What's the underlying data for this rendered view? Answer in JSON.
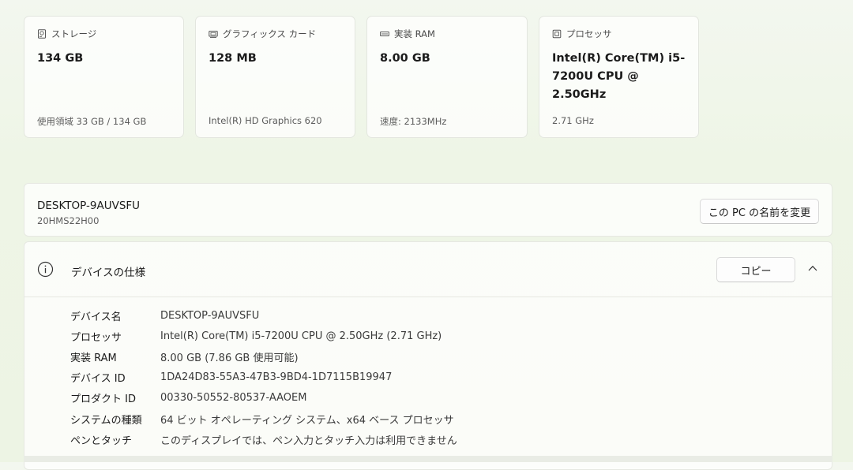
{
  "cards": [
    {
      "label": "ストレージ",
      "value": "134 GB",
      "sub": "使用領域 33 GB / 134 GB",
      "icon": "storage-icon"
    },
    {
      "label": "グラフィックス カード",
      "value": "128 MB",
      "sub": "Intel(R) HD Graphics 620",
      "icon": "graphics-card-icon"
    },
    {
      "label": "実装 RAM",
      "value": "8.00 GB",
      "sub": "速度: 2133MHz",
      "icon": "ram-icon"
    },
    {
      "label": "プロセッサ",
      "value": "Intel(R) Core(TM) i5-7200U CPU @ 2.50GHz",
      "sub": "2.71 GHz",
      "icon": "processor-icon"
    }
  ],
  "device": {
    "name": "DESKTOP-9AUVSFU",
    "model": "20HMS22H00",
    "rename_label": "この PC の名前を変更"
  },
  "specs": {
    "title": "デバイスの仕様",
    "copy_label": "コピー",
    "rows": [
      {
        "k": "デバイス名",
        "v": "DESKTOP-9AUVSFU"
      },
      {
        "k": "プロセッサ",
        "v": "Intel(R) Core(TM) i5-7200U CPU @ 2.50GHz (2.71 GHz)"
      },
      {
        "k": "実装 RAM",
        "v": "8.00 GB (7.86 GB 使用可能)"
      },
      {
        "k": "デバイス ID",
        "v": "1DA24D83-55A3-47B3-9BD4-1D7115B19947"
      },
      {
        "k": "プロダクト ID",
        "v": "00330-50552-80537-AAOEM"
      },
      {
        "k": "システムの種類",
        "v": "64 ビット オペレーティング システム、x64 ベース プロセッサ"
      },
      {
        "k": "ペンとタッチ",
        "v": "このディスプレイでは、ペン入力とタッチ入力は利用できません"
      }
    ]
  }
}
